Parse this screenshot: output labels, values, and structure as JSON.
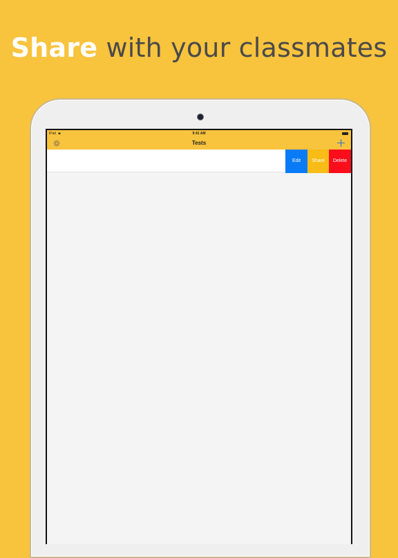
{
  "headline": {
    "bold": "Share",
    "rest": " with your classmates"
  },
  "status_bar": {
    "device": "iPad",
    "time": "9:41 AM"
  },
  "nav": {
    "title": "Tests",
    "left_icon": "gear-icon",
    "right_icon": "plus-icon"
  },
  "row_actions": {
    "edit": "Edit",
    "share": "Share",
    "delete": "Delete"
  },
  "colors": {
    "background": "#F8C33D",
    "edit": "#0A7BF6",
    "share": "#F9BC17",
    "delete": "#FB0D1B"
  }
}
